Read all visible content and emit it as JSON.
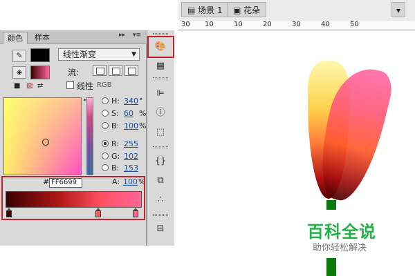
{
  "panel": {
    "tabs": [
      "颜色",
      "样本"
    ],
    "menu_glyph": "▸▸",
    "menu_lines": "▾≡",
    "fill_type": "线性渐变",
    "flow_label": "流:",
    "linear_rgb_label": "线性",
    "rgb_label": "RGB",
    "hsb": [
      {
        "label": "H:",
        "value": "340",
        "unit": "°"
      },
      {
        "label": "S:",
        "value": "60",
        "unit": "%"
      },
      {
        "label": "B:",
        "value": "100",
        "unit": "%"
      }
    ],
    "rgb": [
      {
        "label": "R:",
        "value": "255",
        "selected": true
      },
      {
        "label": "G:",
        "value": "102",
        "selected": false
      },
      {
        "label": "B:",
        "value": "153",
        "selected": false
      }
    ],
    "hex_hash": "#",
    "hex_value": "FF6699",
    "alpha_label": "A:",
    "alpha_value": "100",
    "alpha_unit": "%",
    "gradient_stops": [
      "#3a0000",
      "#ff5a5a",
      "#ff6699"
    ],
    "icons": [
      "pen-icon",
      "paint-bucket-icon",
      "black-white-icon",
      "no-color-icon",
      "swap-colors-icon"
    ]
  },
  "stage": {
    "crumbs": [
      "场景 1",
      "花朵"
    ],
    "ruler": [
      "30",
      "10",
      "10",
      "20",
      "30",
      "40",
      "50"
    ],
    "watermark_title": "百科全说",
    "watermark_sub": "助你轻松解决"
  },
  "colors": {
    "highlight": "#c8202a",
    "stem": "#0a7a0a",
    "accent_green": "#26b04a"
  }
}
